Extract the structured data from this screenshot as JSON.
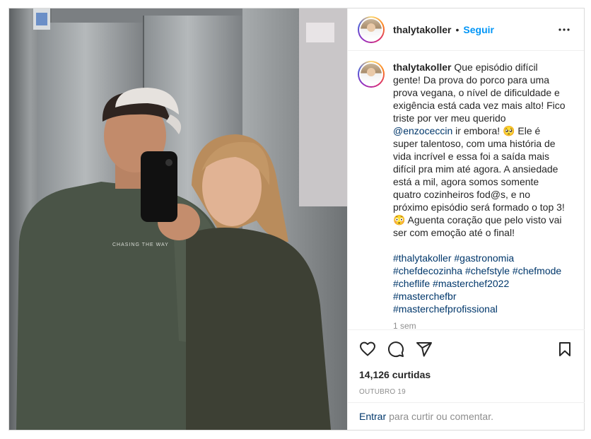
{
  "header": {
    "username": "thalytakoller",
    "separator": "•",
    "follow_label": "Seguir",
    "more_icon": "more-horizontal-icon"
  },
  "caption": {
    "username": "thalytakoller",
    "text_before_mention": "Que episódio difícil gente! Da prova do porco para uma prova vegana, o nível de dificuldade e exigência está cada vez mais alto! Fico triste por ver meu querido",
    "mention": "@enzoceccin",
    "text_after_mention": "ir embora! 🥺 Ele é super talentoso, com uma história de vida incrível e essa foi a saída mais difícil pra mim até agora. A ansiedade está a mil, agora somos somente quatro cozinheiros fod@s, e no próximo episódio será formado o top 3! 😳 Aguenta coração que pelo visto vai ser com emoção até o final!",
    "hashtags": [
      [
        "#thalytakoller",
        "#gastronomia"
      ],
      [
        "#chefdecozinha",
        "#chefstyle",
        "#chefmode"
      ],
      [
        "#cheflife",
        "#masterchef2022"
      ],
      [
        "#masterchefbr"
      ],
      [
        "#masterchefprofissional"
      ]
    ],
    "time": "1 sem"
  },
  "actions": {
    "like_icon": "heart-icon",
    "comment_icon": "comment-icon",
    "share_icon": "paper-plane-icon",
    "save_icon": "bookmark-icon"
  },
  "likes": "14,126 curtidas",
  "date": "OUTUBRO 19",
  "comment_bar": {
    "login_label": "Entrar",
    "prompt": "para curtir ou comentar."
  },
  "photo": {
    "sweatshirt_text": "CHASING THE WAY"
  }
}
